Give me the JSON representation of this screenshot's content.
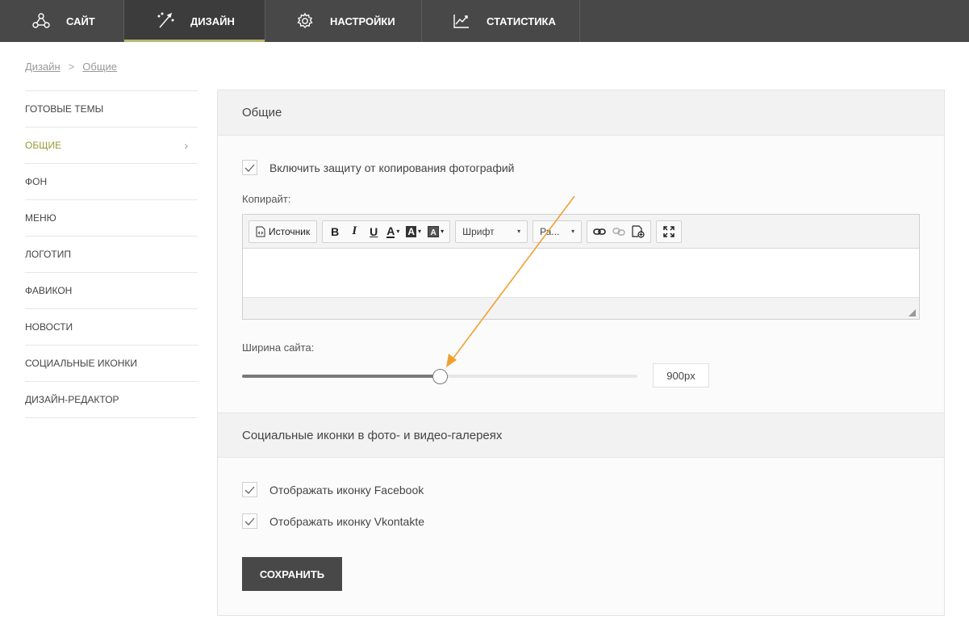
{
  "topnav": {
    "tabs": [
      {
        "label": "САЙТ",
        "icon": "sitemap-icon"
      },
      {
        "label": "ДИЗАЙН",
        "icon": "magic-wand-icon",
        "active": true
      },
      {
        "label": "НАСТРОЙКИ",
        "icon": "gear-icon"
      },
      {
        "label": "СТАТИСТИКА",
        "icon": "line-chart-icon"
      }
    ]
  },
  "breadcrumb": {
    "items": [
      "Дизайн",
      "Общие"
    ],
    "separator": ">"
  },
  "sidebar": {
    "items": [
      {
        "label": "ГОТОВЫЕ ТЕМЫ"
      },
      {
        "label": "ОБЩИЕ",
        "active": true
      },
      {
        "label": "ФОН"
      },
      {
        "label": "МЕНЮ"
      },
      {
        "label": "ЛОГОТИП"
      },
      {
        "label": "ФАВИКОН"
      },
      {
        "label": "НОВОСТИ"
      },
      {
        "label": "СОЦИАЛЬНЫЕ ИКОНКИ"
      },
      {
        "label": "ДИЗАЙН-РЕДАКТОР"
      }
    ]
  },
  "general": {
    "title": "Общие",
    "copy_protection_label": "Включить защиту от копирования фотографий",
    "copy_protection_checked": true,
    "copyright_label": "Копирайт:",
    "editor": {
      "source_label": "Источник",
      "bold": "B",
      "italic": "I",
      "underline": "U",
      "text_color": "A",
      "bg_color": "A",
      "font_placeholder": "Шрифт",
      "size_placeholder": "Ра...",
      "content": ""
    },
    "site_width_label": "Ширина сайта:",
    "site_width_value": "900px",
    "site_width_fraction": 0.5
  },
  "social": {
    "title": "Социальные иконки в фото- и видео-галереях",
    "facebook_label": "Отображать иконку Facebook",
    "facebook_checked": true,
    "vk_label": "Отображать иконку Vkontakte",
    "vk_checked": true
  },
  "save_label": "СОХРАНИТЬ",
  "colors": {
    "nav_bg": "#484848",
    "accent": "#b8b870",
    "active_sidebar": "#9a9a3c",
    "annotation_arrow": "#f0a030"
  }
}
